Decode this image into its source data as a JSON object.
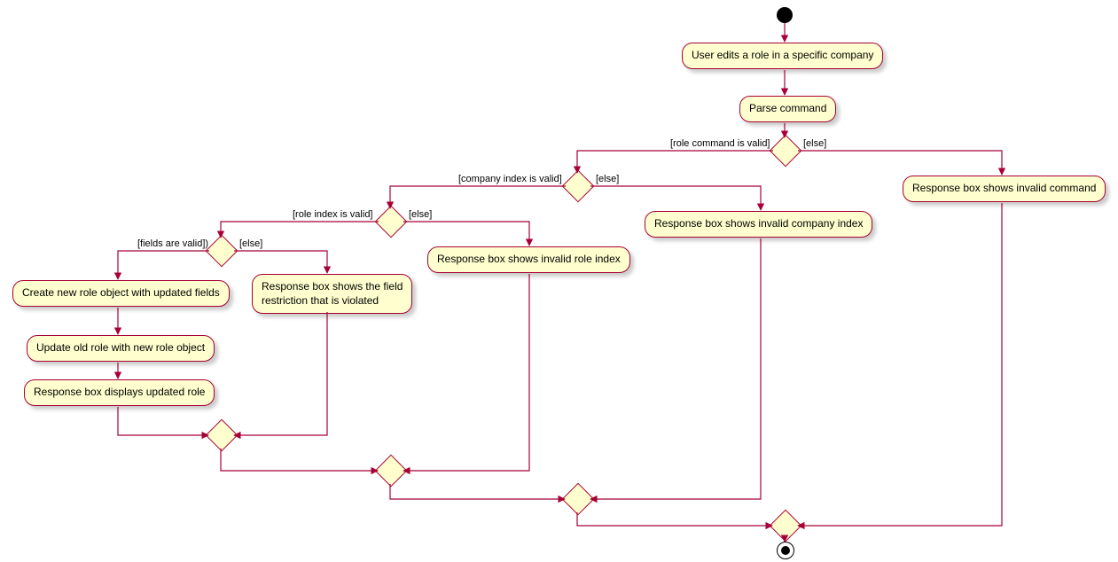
{
  "activities": {
    "a1": "User edits a role in a specific company",
    "a2": "Parse command",
    "a3": "Response box shows invalid command",
    "a4": "Response box shows invalid company index",
    "a5": "Response box shows invalid role index",
    "a6": "Response box shows the field\nrestriction that is violated",
    "a7": "Create new role object with updated fields",
    "a8": "Update old role with new role object",
    "a9": "Response box displays updated role"
  },
  "guards": {
    "g1_left": "[role command is valid]",
    "g1_right": "[else]",
    "g2_left": "[company index is valid]",
    "g2_right": "[else]",
    "g3_left": "[role index is valid]",
    "g3_right": "[else]",
    "g4_left": "[fields are valid])",
    "g4_right": "[else]"
  }
}
